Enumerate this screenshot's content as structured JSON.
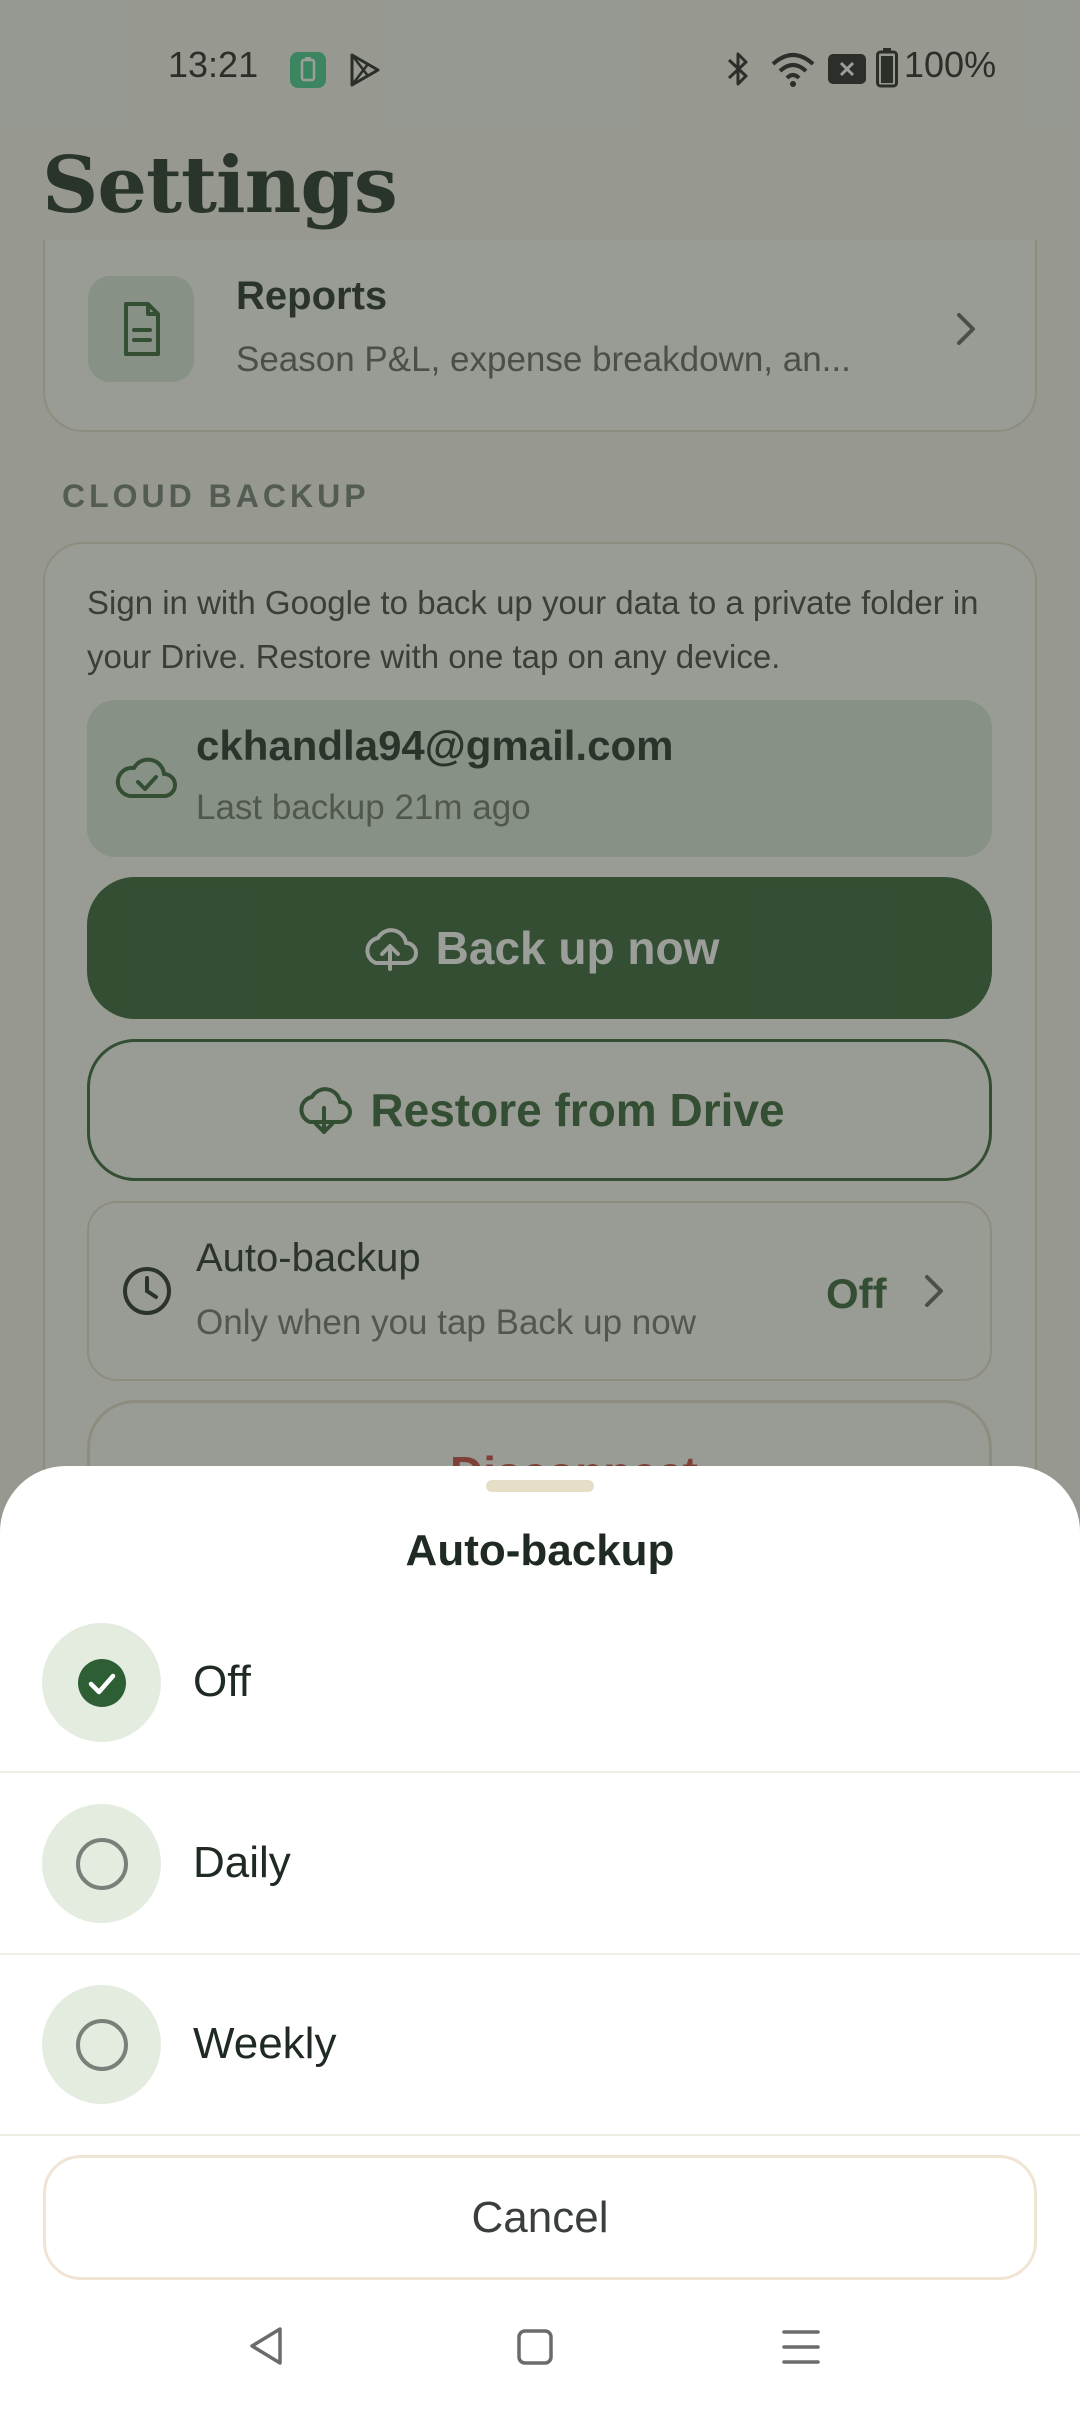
{
  "status_bar": {
    "time": "13:21",
    "battery": "100%",
    "icons": [
      "battery-saver-icon",
      "play-store-icon",
      "bluetooth-icon",
      "wifi-icon",
      "no-sim-icon",
      "battery-icon"
    ]
  },
  "page": {
    "title": "Settings"
  },
  "reports": {
    "title": "Reports",
    "subtitle": "Season P&L, expense breakdown, an..."
  },
  "cloud_backup": {
    "section_label": "CLOUD BACKUP",
    "description": "Sign in with Google to back up your data to a private folder in your Drive. Restore with one tap on any device.",
    "account_email": "ckhandla94@gmail.com",
    "last_backup": "Last backup 21m ago",
    "backup_now_label": "Back up now",
    "restore_label": "Restore from Drive",
    "auto_backup_title": "Auto-backup",
    "auto_backup_subtitle": "Only when you tap Back up now",
    "auto_backup_value": "Off",
    "disconnect_label": "Disconnect"
  },
  "sheet": {
    "title": "Auto-backup",
    "options": [
      {
        "label": "Off",
        "selected": true
      },
      {
        "label": "Daily",
        "selected": false
      },
      {
        "label": "Weekly",
        "selected": false
      }
    ],
    "cancel_label": "Cancel"
  },
  "colors": {
    "primary": "#2e5e33",
    "danger": "#c4433a",
    "chip_bg": "#d9e4d6",
    "background": "#f6f5ef"
  }
}
